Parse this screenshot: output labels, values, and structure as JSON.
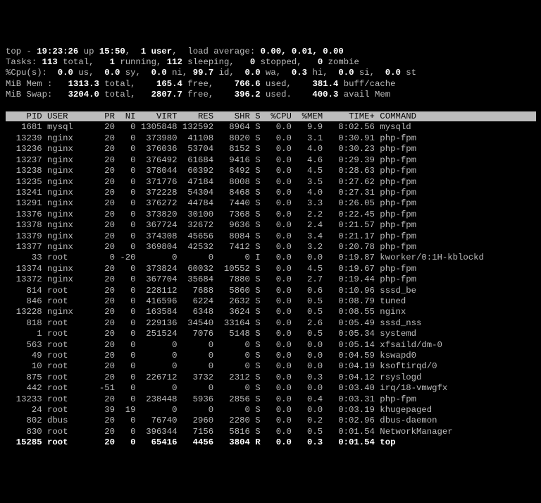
{
  "summary": {
    "l1_a": "top - ",
    "time": "19:23:26",
    "l1_b": " up ",
    "uptime": "15:50",
    "l1_c": ",  ",
    "users": "1 user",
    "l1_d": ",  load average: ",
    "load": "0.00, 0.01, 0.00",
    "l2_a": "Tasks: ",
    "t_tot": "113",
    "l2_b": " total,   ",
    "t_run": "1",
    "l2_c": " running, ",
    "t_slp": "112",
    "l2_d": " sleeping,   ",
    "t_stp": "0",
    "l2_e": " stopped,   ",
    "t_zmb": "0",
    "l2_f": " zombie",
    "l3_a": "%Cpu(s):  ",
    "us": "0.0",
    "l3_b": " us,  ",
    "sy": "0.0",
    "l3_c": " sy,  ",
    "ni": "0.0",
    "l3_d": " ni, ",
    "id": "99.7",
    "l3_e": " id,  ",
    "wa": "0.0",
    "l3_f": " wa,  ",
    "hi": "0.3",
    "l3_g": " hi,  ",
    "si": "0.0",
    "l3_h": " si,  ",
    "st": "0.0",
    "l3_i": " st",
    "l4_a": "MiB Mem :   ",
    "m_tot": "1313.3",
    "l4_b": " total,    ",
    "m_free": "165.4",
    "l4_c": " free,    ",
    "m_used": "766.6",
    "l4_d": " used,    ",
    "m_bc": "381.4",
    "l4_e": " buff/cache",
    "l5_a": "MiB Swap:   ",
    "s_tot": "3204.0",
    "l5_b": " total,   ",
    "s_free": "2807.7",
    "l5_c": " free,    ",
    "s_used": "396.2",
    "l5_d": " used.    ",
    "s_av": "400.3",
    "l5_e": " avail Mem "
  },
  "cols": [
    "PID",
    "USER",
    "PR",
    "NI",
    "VIRT",
    "RES",
    "SHR",
    "S",
    "%CPU",
    "%MEM",
    "TIME+",
    "COMMAND"
  ],
  "rows": [
    {
      "pid": "1681",
      "user": "mysql",
      "pr": "20",
      "ni": "0",
      "virt": "1305848",
      "res": "132592",
      "shr": "8964",
      "s": "S",
      "cpu": "0.0",
      "mem": "9.9",
      "time": "8:02.56",
      "cmd": "mysqld"
    },
    {
      "pid": "13239",
      "user": "nginx",
      "pr": "20",
      "ni": "0",
      "virt": "373980",
      "res": "41108",
      "shr": "8020",
      "s": "S",
      "cpu": "0.0",
      "mem": "3.1",
      "time": "0:30.91",
      "cmd": "php-fpm"
    },
    {
      "pid": "13236",
      "user": "nginx",
      "pr": "20",
      "ni": "0",
      "virt": "376036",
      "res": "53704",
      "shr": "8152",
      "s": "S",
      "cpu": "0.0",
      "mem": "4.0",
      "time": "0:30.23",
      "cmd": "php-fpm"
    },
    {
      "pid": "13237",
      "user": "nginx",
      "pr": "20",
      "ni": "0",
      "virt": "376492",
      "res": "61684",
      "shr": "9416",
      "s": "S",
      "cpu": "0.0",
      "mem": "4.6",
      "time": "0:29.39",
      "cmd": "php-fpm"
    },
    {
      "pid": "13238",
      "user": "nginx",
      "pr": "20",
      "ni": "0",
      "virt": "378044",
      "res": "60392",
      "shr": "8492",
      "s": "S",
      "cpu": "0.0",
      "mem": "4.5",
      "time": "0:28.63",
      "cmd": "php-fpm"
    },
    {
      "pid": "13235",
      "user": "nginx",
      "pr": "20",
      "ni": "0",
      "virt": "371776",
      "res": "47184",
      "shr": "8008",
      "s": "S",
      "cpu": "0.0",
      "mem": "3.5",
      "time": "0:27.62",
      "cmd": "php-fpm"
    },
    {
      "pid": "13241",
      "user": "nginx",
      "pr": "20",
      "ni": "0",
      "virt": "372228",
      "res": "54304",
      "shr": "8468",
      "s": "S",
      "cpu": "0.0",
      "mem": "4.0",
      "time": "0:27.31",
      "cmd": "php-fpm"
    },
    {
      "pid": "13291",
      "user": "nginx",
      "pr": "20",
      "ni": "0",
      "virt": "376272",
      "res": "44784",
      "shr": "7440",
      "s": "S",
      "cpu": "0.0",
      "mem": "3.3",
      "time": "0:26.05",
      "cmd": "php-fpm"
    },
    {
      "pid": "13376",
      "user": "nginx",
      "pr": "20",
      "ni": "0",
      "virt": "373820",
      "res": "30100",
      "shr": "7368",
      "s": "S",
      "cpu": "0.0",
      "mem": "2.2",
      "time": "0:22.45",
      "cmd": "php-fpm"
    },
    {
      "pid": "13378",
      "user": "nginx",
      "pr": "20",
      "ni": "0",
      "virt": "367724",
      "res": "32672",
      "shr": "9636",
      "s": "S",
      "cpu": "0.0",
      "mem": "2.4",
      "time": "0:21.57",
      "cmd": "php-fpm"
    },
    {
      "pid": "13379",
      "user": "nginx",
      "pr": "20",
      "ni": "0",
      "virt": "374308",
      "res": "45656",
      "shr": "8084",
      "s": "S",
      "cpu": "0.0",
      "mem": "3.4",
      "time": "0:21.17",
      "cmd": "php-fpm"
    },
    {
      "pid": "13377",
      "user": "nginx",
      "pr": "20",
      "ni": "0",
      "virt": "369804",
      "res": "42532",
      "shr": "7412",
      "s": "S",
      "cpu": "0.0",
      "mem": "3.2",
      "time": "0:20.78",
      "cmd": "php-fpm"
    },
    {
      "pid": "33",
      "user": "root",
      "pr": "0",
      "ni": "-20",
      "virt": "0",
      "res": "0",
      "shr": "0",
      "s": "I",
      "cpu": "0.0",
      "mem": "0.0",
      "time": "0:19.87",
      "cmd": "kworker/0:1H-kblockd"
    },
    {
      "pid": "13374",
      "user": "nginx",
      "pr": "20",
      "ni": "0",
      "virt": "373824",
      "res": "60032",
      "shr": "10552",
      "s": "S",
      "cpu": "0.0",
      "mem": "4.5",
      "time": "0:19.67",
      "cmd": "php-fpm"
    },
    {
      "pid": "13372",
      "user": "nginx",
      "pr": "20",
      "ni": "0",
      "virt": "367704",
      "res": "35684",
      "shr": "7880",
      "s": "S",
      "cpu": "0.0",
      "mem": "2.7",
      "time": "0:19.44",
      "cmd": "php-fpm"
    },
    {
      "pid": "814",
      "user": "root",
      "pr": "20",
      "ni": "0",
      "virt": "228112",
      "res": "7688",
      "shr": "5860",
      "s": "S",
      "cpu": "0.0",
      "mem": "0.6",
      "time": "0:10.96",
      "cmd": "sssd_be"
    },
    {
      "pid": "846",
      "user": "root",
      "pr": "20",
      "ni": "0",
      "virt": "416596",
      "res": "6224",
      "shr": "2632",
      "s": "S",
      "cpu": "0.0",
      "mem": "0.5",
      "time": "0:08.79",
      "cmd": "tuned"
    },
    {
      "pid": "13228",
      "user": "nginx",
      "pr": "20",
      "ni": "0",
      "virt": "163584",
      "res": "6348",
      "shr": "3624",
      "s": "S",
      "cpu": "0.0",
      "mem": "0.5",
      "time": "0:08.55",
      "cmd": "nginx"
    },
    {
      "pid": "818",
      "user": "root",
      "pr": "20",
      "ni": "0",
      "virt": "229136",
      "res": "34540",
      "shr": "33164",
      "s": "S",
      "cpu": "0.0",
      "mem": "2.6",
      "time": "0:05.49",
      "cmd": "sssd_nss"
    },
    {
      "pid": "1",
      "user": "root",
      "pr": "20",
      "ni": "0",
      "virt": "251524",
      "res": "7076",
      "shr": "5148",
      "s": "S",
      "cpu": "0.0",
      "mem": "0.5",
      "time": "0:05.34",
      "cmd": "systemd"
    },
    {
      "pid": "563",
      "user": "root",
      "pr": "20",
      "ni": "0",
      "virt": "0",
      "res": "0",
      "shr": "0",
      "s": "S",
      "cpu": "0.0",
      "mem": "0.0",
      "time": "0:05.14",
      "cmd": "xfsaild/dm-0"
    },
    {
      "pid": "49",
      "user": "root",
      "pr": "20",
      "ni": "0",
      "virt": "0",
      "res": "0",
      "shr": "0",
      "s": "S",
      "cpu": "0.0",
      "mem": "0.0",
      "time": "0:04.59",
      "cmd": "kswapd0"
    },
    {
      "pid": "10",
      "user": "root",
      "pr": "20",
      "ni": "0",
      "virt": "0",
      "res": "0",
      "shr": "0",
      "s": "S",
      "cpu": "0.0",
      "mem": "0.0",
      "time": "0:04.19",
      "cmd": "ksoftirqd/0"
    },
    {
      "pid": "875",
      "user": "root",
      "pr": "20",
      "ni": "0",
      "virt": "226712",
      "res": "3732",
      "shr": "2312",
      "s": "S",
      "cpu": "0.0",
      "mem": "0.3",
      "time": "0:04.12",
      "cmd": "rsyslogd"
    },
    {
      "pid": "442",
      "user": "root",
      "pr": "-51",
      "ni": "0",
      "virt": "0",
      "res": "0",
      "shr": "0",
      "s": "S",
      "cpu": "0.0",
      "mem": "0.0",
      "time": "0:03.40",
      "cmd": "irq/18-vmwgfx"
    },
    {
      "pid": "13233",
      "user": "root",
      "pr": "20",
      "ni": "0",
      "virt": "238448",
      "res": "5936",
      "shr": "2856",
      "s": "S",
      "cpu": "0.0",
      "mem": "0.4",
      "time": "0:03.31",
      "cmd": "php-fpm"
    },
    {
      "pid": "24",
      "user": "root",
      "pr": "39",
      "ni": "19",
      "virt": "0",
      "res": "0",
      "shr": "0",
      "s": "S",
      "cpu": "0.0",
      "mem": "0.0",
      "time": "0:03.19",
      "cmd": "khugepaged"
    },
    {
      "pid": "802",
      "user": "dbus",
      "pr": "20",
      "ni": "0",
      "virt": "76740",
      "res": "2960",
      "shr": "2280",
      "s": "S",
      "cpu": "0.0",
      "mem": "0.2",
      "time": "0:02.96",
      "cmd": "dbus-daemon"
    },
    {
      "pid": "830",
      "user": "root",
      "pr": "20",
      "ni": "0",
      "virt": "396344",
      "res": "7156",
      "shr": "5816",
      "s": "S",
      "cpu": "0.0",
      "mem": "0.5",
      "time": "0:01.54",
      "cmd": "NetworkManager"
    },
    {
      "pid": "15285",
      "user": "root",
      "pr": "20",
      "ni": "0",
      "virt": "65416",
      "res": "4456",
      "shr": "3804",
      "s": "R",
      "cpu": "0.0",
      "mem": "0.3",
      "time": "0:01.54",
      "cmd": "top",
      "sel": true
    }
  ]
}
